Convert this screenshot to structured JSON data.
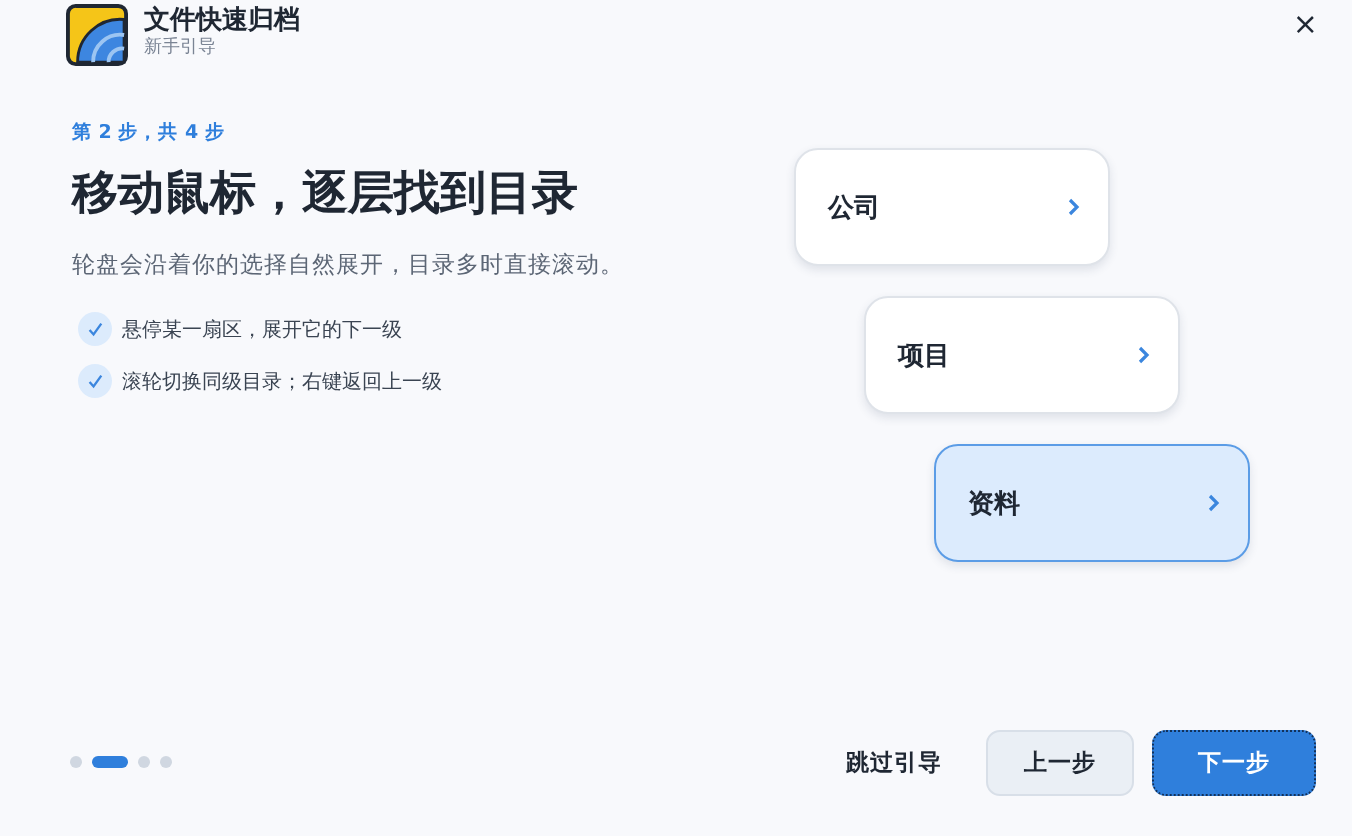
{
  "app": {
    "title": "文件快速归档",
    "subtitle": "新手引导",
    "close": "×"
  },
  "step": {
    "label": "第 2 步，共 4 步",
    "heading": "移动鼠标，逐层找到目录",
    "description": "轮盘会沿着你的选择自然展开，目录多时直接滚动。"
  },
  "tips": [
    {
      "text": "悬停某一扇区，展开它的下一级",
      "checked": true
    },
    {
      "text": "滚轮切换同级目录；右键返回上一级",
      "checked": true
    }
  ],
  "folders": [
    {
      "label": "公司",
      "selected": false
    },
    {
      "label": "项目",
      "selected": false
    },
    {
      "label": "资料",
      "selected": true
    }
  ],
  "pager": [
    {
      "selected": false
    },
    {
      "selected": true
    },
    {
      "selected": false
    },
    {
      "selected": false
    }
  ],
  "buttons": {
    "skip": "跳过引导",
    "prev": "上一步",
    "next": "下一步"
  }
}
